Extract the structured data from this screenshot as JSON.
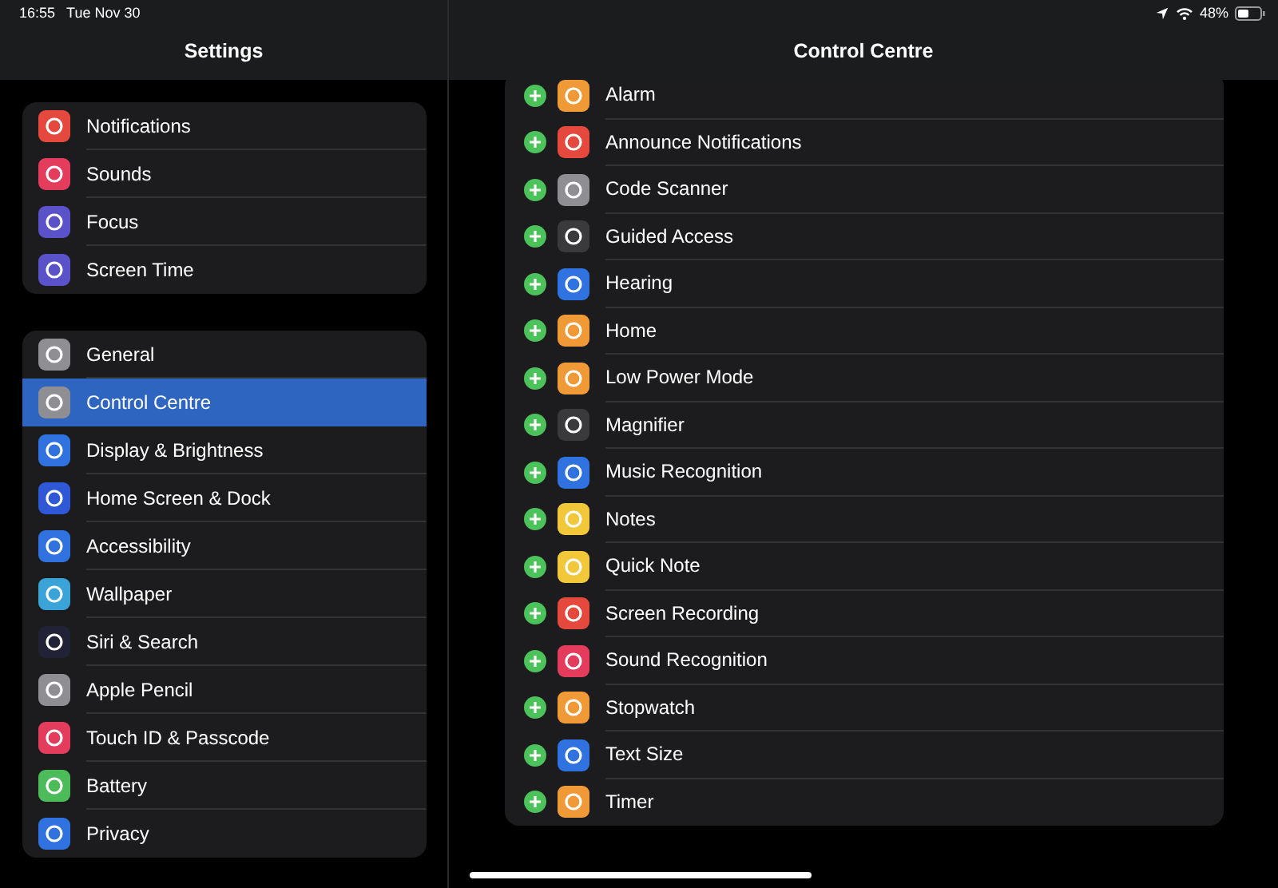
{
  "status_bar": {
    "time": "16:55",
    "date": "Tue Nov 30",
    "battery": "48%"
  },
  "sidebar": {
    "title": "Settings",
    "groups": [
      [
        {
          "label": "Notifications",
          "color": "#e5483c",
          "selected": false
        },
        {
          "label": "Sounds",
          "color": "#e43c5c",
          "selected": false
        },
        {
          "label": "Focus",
          "color": "#5a52c9",
          "selected": false
        },
        {
          "label": "Screen Time",
          "color": "#5a52c9",
          "selected": false
        }
      ],
      [
        {
          "label": "General",
          "color": "#8e8e93",
          "selected": false
        },
        {
          "label": "Control Centre",
          "color": "#8e8e93",
          "selected": true
        },
        {
          "label": "Display & Brightness",
          "color": "#2f72e0",
          "selected": false
        },
        {
          "label": "Home Screen & Dock",
          "color": "#2f58d6",
          "selected": false
        },
        {
          "label": "Accessibility",
          "color": "#2f72e0",
          "selected": false
        },
        {
          "label": "Wallpaper",
          "color": "#3aa3d8",
          "selected": false
        },
        {
          "label": "Siri & Search",
          "color": "#222236",
          "selected": false
        },
        {
          "label": "Apple Pencil",
          "color": "#8e8e93",
          "selected": false
        },
        {
          "label": "Touch ID & Passcode",
          "color": "#e43c5c",
          "selected": false
        },
        {
          "label": "Battery",
          "color": "#4cbb5a",
          "selected": false
        },
        {
          "label": "Privacy",
          "color": "#2f72e0",
          "selected": false
        }
      ]
    ]
  },
  "detail": {
    "title": "Control Centre",
    "controls": [
      {
        "label": "Alarm",
        "color": "#f09a37"
      },
      {
        "label": "Announce Notifications",
        "color": "#e5483c"
      },
      {
        "label": "Code Scanner",
        "color": "#8e8e93"
      },
      {
        "label": "Guided Access",
        "color": "#3a3a3c"
      },
      {
        "label": "Hearing",
        "color": "#2f72e0"
      },
      {
        "label": "Home",
        "color": "#f09a37"
      },
      {
        "label": "Low Power Mode",
        "color": "#f09a37"
      },
      {
        "label": "Magnifier",
        "color": "#3a3a3c"
      },
      {
        "label": "Music Recognition",
        "color": "#2f72e0"
      },
      {
        "label": "Notes",
        "color": "#f2c83a"
      },
      {
        "label": "Quick Note",
        "color": "#f2c83a"
      },
      {
        "label": "Screen Recording",
        "color": "#e5483c"
      },
      {
        "label": "Sound Recognition",
        "color": "#e43c5c"
      },
      {
        "label": "Stopwatch",
        "color": "#f09a37"
      },
      {
        "label": "Text Size",
        "color": "#2f72e0"
      },
      {
        "label": "Timer",
        "color": "#f09a37"
      }
    ]
  }
}
